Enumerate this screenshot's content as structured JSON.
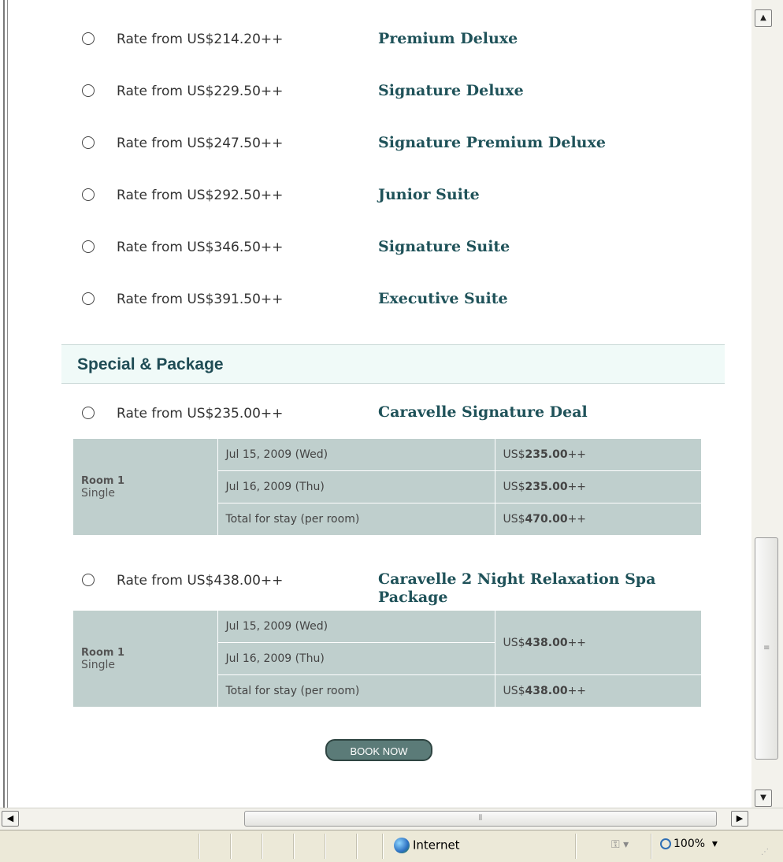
{
  "rooms": [
    {
      "rate": "Rate from US$214.20++",
      "name": "Premium Deluxe"
    },
    {
      "rate": "Rate from US$229.50++",
      "name": "Signature Deluxe"
    },
    {
      "rate": "Rate from US$247.50++",
      "name": "Signature Premium Deluxe"
    },
    {
      "rate": "Rate from US$292.50++",
      "name": "Junior Suite"
    },
    {
      "rate": "Rate from US$346.50++",
      "name": "Signature Suite"
    },
    {
      "rate": "Rate from US$391.50++",
      "name": "Executive Suite"
    }
  ],
  "special": {
    "heading": "Special & Package",
    "packages": [
      {
        "rate": "Rate from US$235.00++",
        "name": "Caravelle Signature Deal",
        "room_title": "Room 1",
        "room_type": "Single",
        "rows": [
          {
            "date": "Jul 15, 2009 (Wed)",
            "prefix": "US$",
            "amount": "235.00",
            "suffix": "++"
          },
          {
            "date": "Jul 16, 2009 (Thu)",
            "prefix": "US$",
            "amount": "235.00",
            "suffix": "++"
          }
        ],
        "total_label": "Total for stay (per room)",
        "total": {
          "prefix": "US$",
          "amount": "470.00",
          "suffix": "++"
        }
      },
      {
        "rate": "Rate from US$438.00++",
        "name_line1": "Caravelle 2 Night Relaxation Spa",
        "name_line2": "Package",
        "room_title": "Room 1",
        "room_type": "Single",
        "rows": [
          {
            "date": "Jul 15, 2009 (Wed)"
          },
          {
            "date": "Jul 16, 2009 (Thu)"
          }
        ],
        "combined": {
          "prefix": "US$",
          "amount": "438.00",
          "suffix": "++"
        },
        "total_label": "Total for stay (per room)",
        "total": {
          "prefix": "US$",
          "amount": "438.00",
          "suffix": "++"
        }
      }
    ]
  },
  "book_button": "BOOK NOW",
  "status": {
    "zone": "Internet",
    "zoom": "100%"
  },
  "colors": {
    "room_name": "#1f5259",
    "table_bg": "#bfcfcd",
    "section_bg": "#f0faf8",
    "button_bg": "#5b7b78"
  }
}
